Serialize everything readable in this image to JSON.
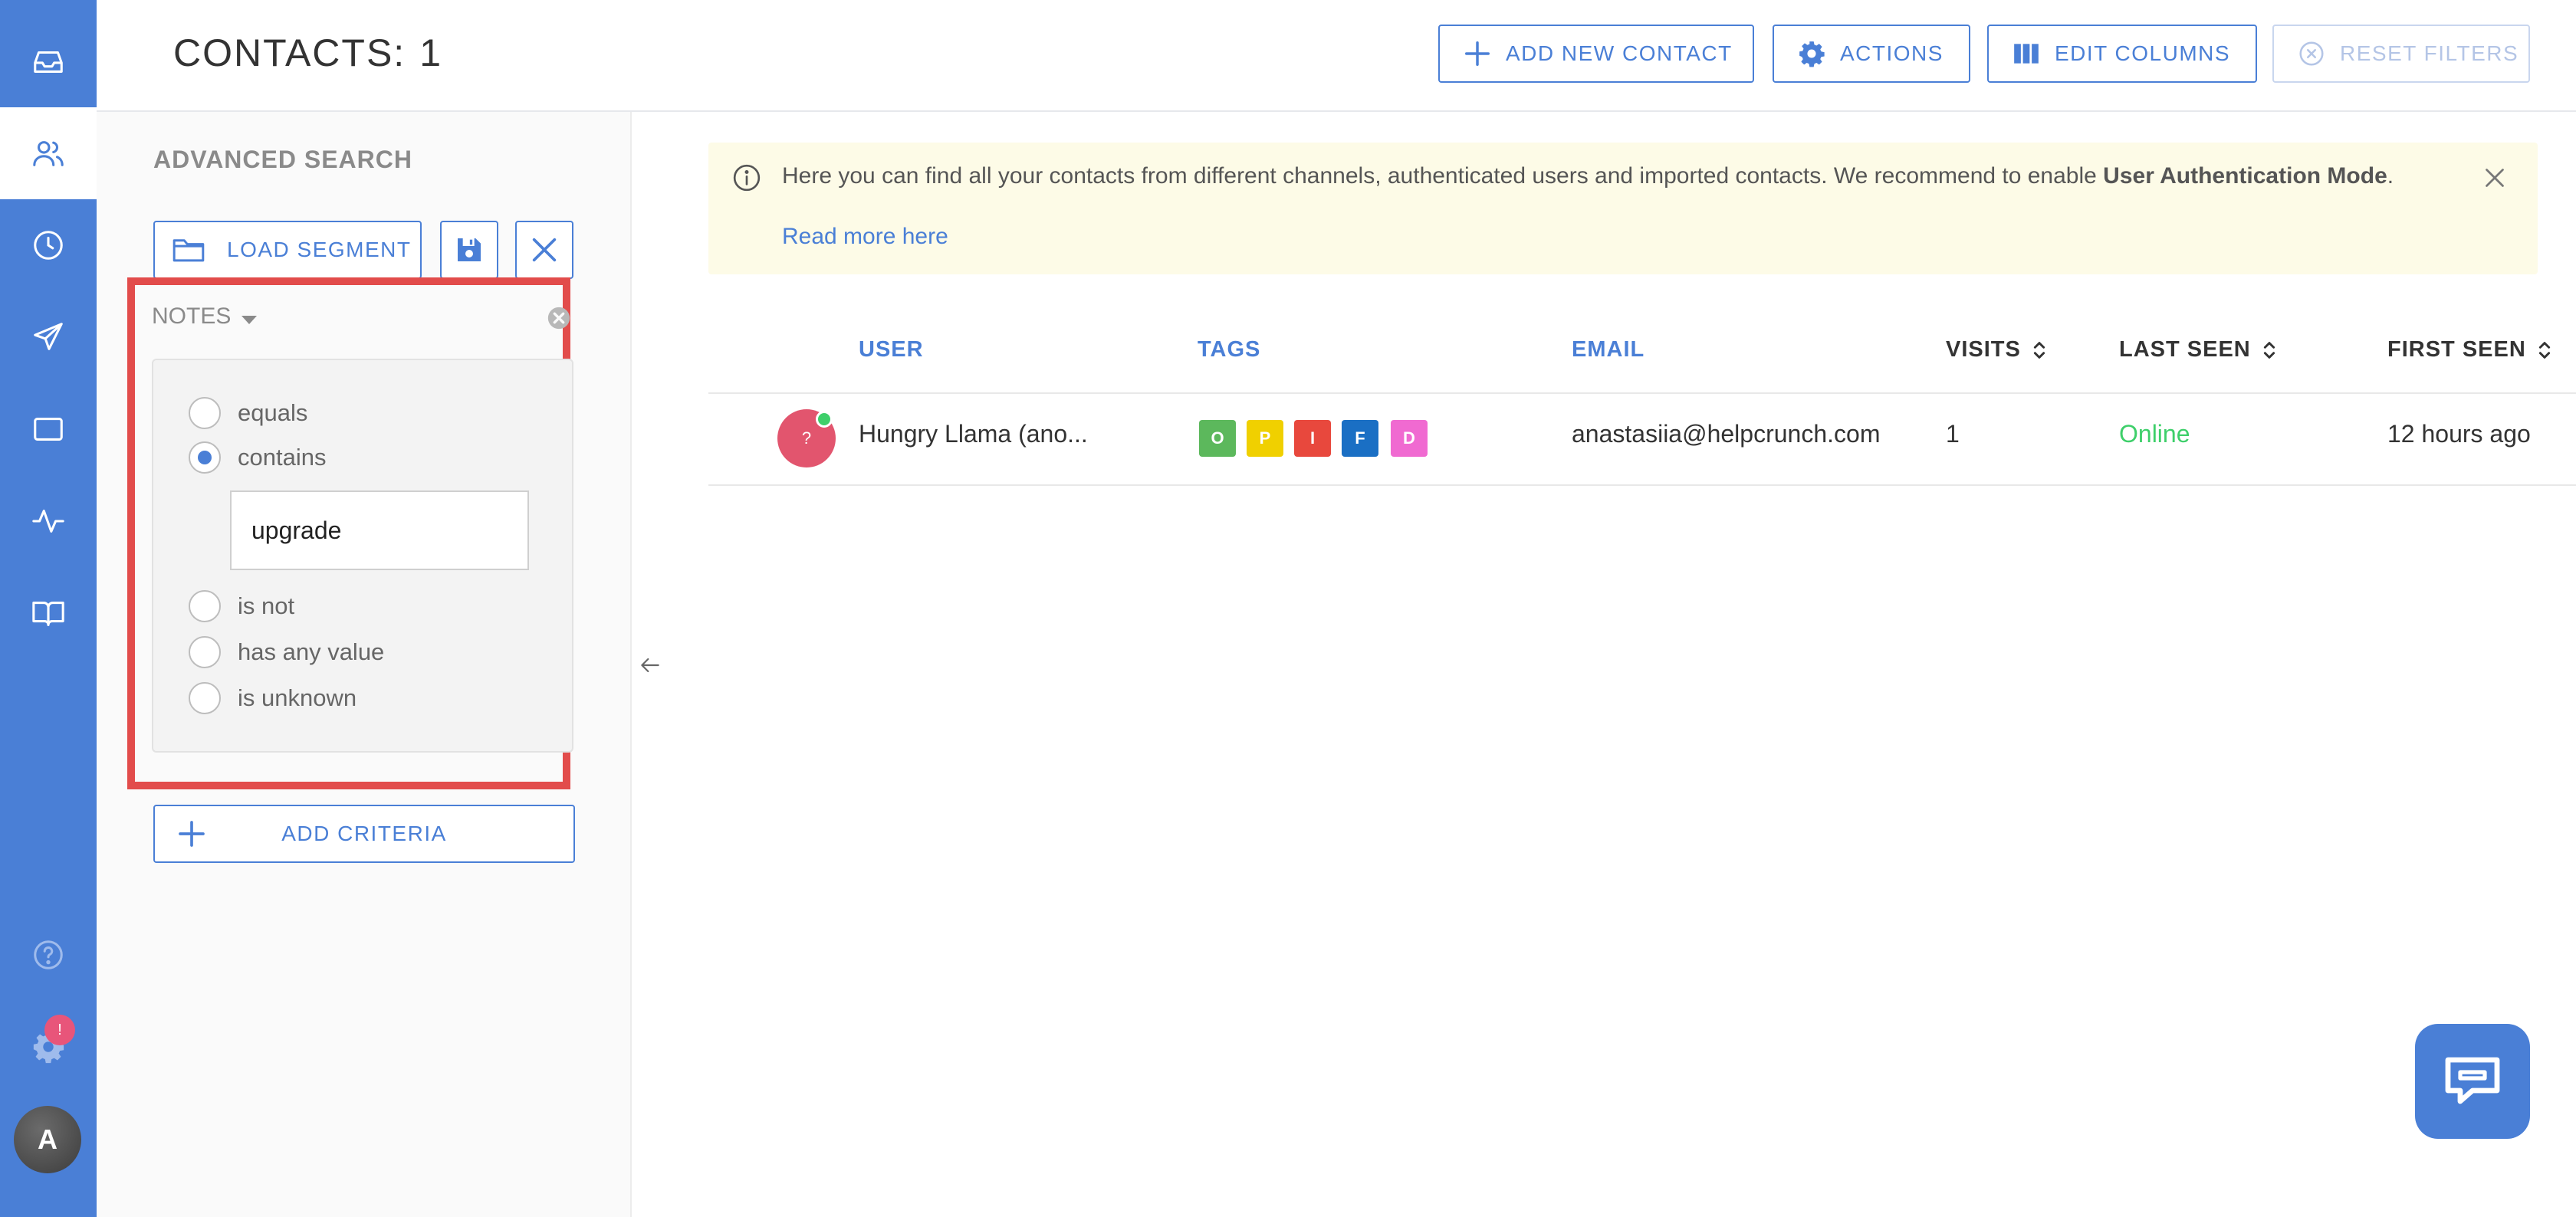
{
  "nav": {
    "items": [
      {
        "name": "inbox-icon"
      },
      {
        "name": "contacts-icon",
        "active": true
      },
      {
        "name": "clock-icon"
      },
      {
        "name": "send-icon"
      },
      {
        "name": "window-icon"
      },
      {
        "name": "pulse-icon"
      },
      {
        "name": "book-icon"
      }
    ],
    "help_icon": "help-icon",
    "settings_icon": "gear-icon",
    "settings_badge": "!",
    "avatar_initial": "A"
  },
  "header": {
    "title": "CONTACTS:",
    "count": "1",
    "buttons": {
      "add_new_contact": "ADD NEW CONTACT",
      "actions": "ACTIONS",
      "edit_columns": "EDIT COLUMNS",
      "reset_filters": "RESET FILTERS"
    }
  },
  "filters": {
    "title": "ADVANCED SEARCH",
    "load_segment": "LOAD SEGMENT",
    "criterion": {
      "field": "NOTES",
      "options": [
        {
          "label": "equals",
          "checked": false
        },
        {
          "label": "contains",
          "checked": true
        },
        {
          "label": "is not",
          "checked": false
        },
        {
          "label": "has any value",
          "checked": false
        },
        {
          "label": "is unknown",
          "checked": false
        }
      ],
      "value": "upgrade"
    },
    "add_criteria": "ADD CRITERIA"
  },
  "info": {
    "text_before": "Here you can find all your contacts from different channels, authenticated users and imported contacts. We recommend to enable ",
    "text_bold": "User Authentication Mode",
    "text_after": ".",
    "link": "Read more here"
  },
  "table": {
    "columns": {
      "user": "USER",
      "tags": "TAGS",
      "email": "EMAIL",
      "visits": "VISITS",
      "last_seen": "LAST SEEN",
      "first_seen": "FIRST SEEN"
    },
    "rows": [
      {
        "avatar": "?",
        "user": "Hungry Llama (ano...",
        "tags": [
          {
            "letter": "O",
            "color": "#5cb85c"
          },
          {
            "letter": "P",
            "color": "#f0d000"
          },
          {
            "letter": "I",
            "color": "#e8483d"
          },
          {
            "letter": "F",
            "color": "#1a6fc4"
          },
          {
            "letter": "D",
            "color": "#f06ad1"
          }
        ],
        "email": "anastasiia@helpcrunch.com",
        "visits": "1",
        "last_seen": "Online",
        "first_seen": "12 hours ago"
      }
    ]
  },
  "colors": {
    "accent": "#4a7fd6",
    "highlight": "#e24c4b",
    "online": "#3ecf6a",
    "info_bg": "#fdfbe7"
  }
}
